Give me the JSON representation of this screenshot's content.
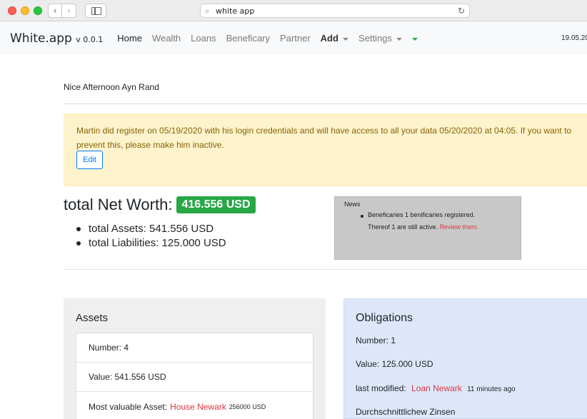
{
  "browser": {
    "url": "white app",
    "back_icon": "chevron-left-icon",
    "forward_icon": "chevron-right-icon",
    "sidebar_icon": "sidebar-icon",
    "search_icon": "search-icon",
    "reload_icon": "reload-icon"
  },
  "navbar": {
    "brand": "White.app",
    "version": "v 0.0.1",
    "items": [
      {
        "label": "Home"
      },
      {
        "label": "Wealth"
      },
      {
        "label": "Loans"
      },
      {
        "label": "Beneficary"
      },
      {
        "label": "Partner"
      },
      {
        "label": "Add"
      },
      {
        "label": "Settings"
      }
    ],
    "date": "19.05.20"
  },
  "greeting": "Nice Afternoon Ayn Rand",
  "alert": {
    "text": "Martin did register on 05/19/2020 with his login credentials and will have access to all your data 05/20/2020 at 04:05. If you want to prevent this, please make him inactive.",
    "edit_label": "Edit"
  },
  "networth": {
    "label": "total Net Worth:",
    "value": "416.556 USD",
    "assets": "total Assets: 541.556 USD",
    "liabilities": "total Liabilities: 125.000 USD",
    "badge_color": "#28a745"
  },
  "news": {
    "title": "News",
    "line1": "Beneficaries 1 benificaries registered.",
    "line2": "Thereof 1 are still active.",
    "link": "Review them."
  },
  "assets": {
    "title": "Assets",
    "number": "Number: 4",
    "value": "Value: 541.556 USD",
    "most_valuable_label": "Most valuable Asset:",
    "most_valuable_link": "House Newark",
    "most_valuable_amount": "256000 USD"
  },
  "obligations": {
    "title": "Obligations",
    "number": "Number: 1",
    "value": "Value: 125.000 USD",
    "last_modified_label": "last modified:",
    "last_modified_link": "Loan Newark",
    "last_modified_time": "11 minutes ago",
    "interest": "Durchschnittlichew Zinsen"
  }
}
